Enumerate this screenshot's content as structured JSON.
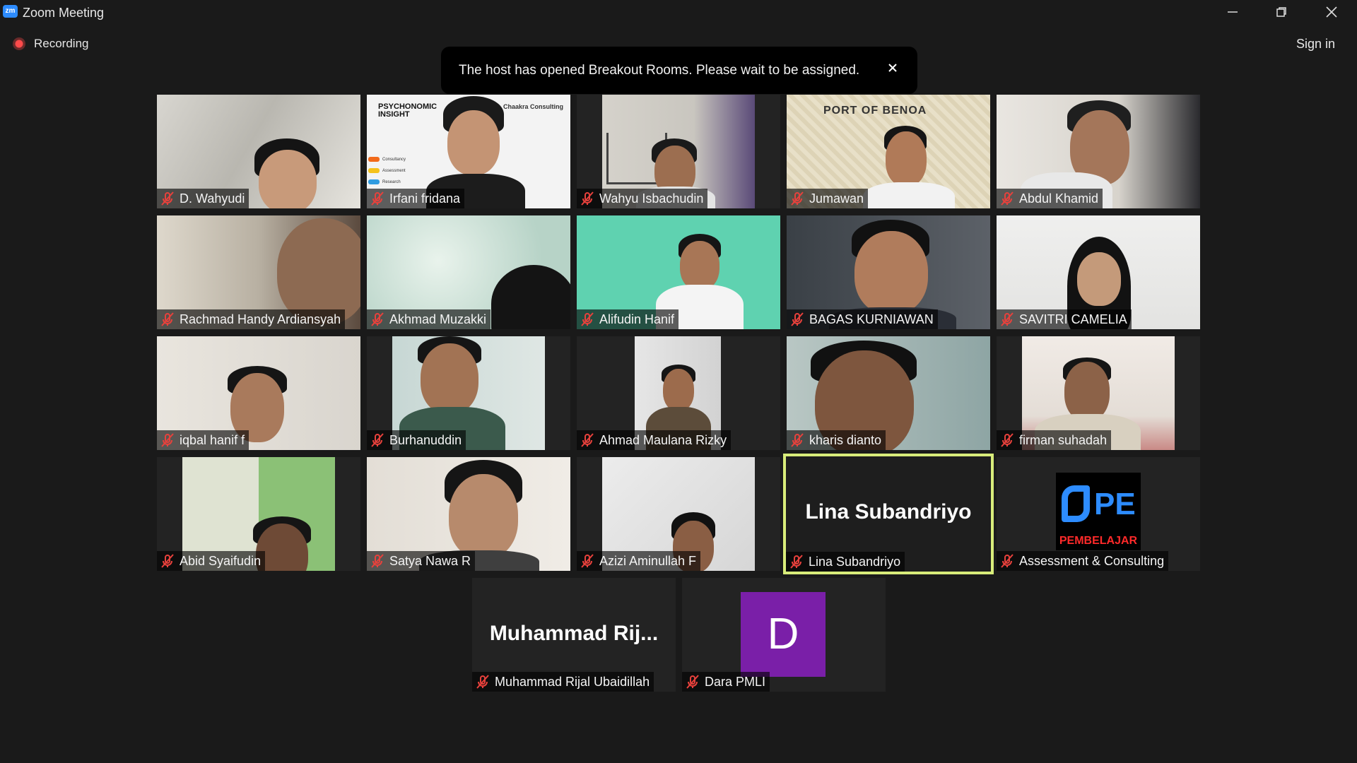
{
  "window": {
    "app_logo": "zm",
    "title": "Zoom Meeting"
  },
  "recording_label": "Recording",
  "sign_in_label": "Sign in",
  "toast": {
    "message": "The host has opened Breakout Rooms. Please wait to be assigned."
  },
  "participants": [
    {
      "name": "D. Wahyudi",
      "muted": true
    },
    {
      "name": "Irfani fridana",
      "muted": true,
      "poster": {
        "title": "PSYCHONOMIC INSIGHT",
        "brand": "Chaakra Consulting",
        "items": [
          "Consultancy",
          "Assessment",
          "Research"
        ]
      }
    },
    {
      "name": "Wahyu Isbachudin",
      "muted": true
    },
    {
      "name": "Jumawan",
      "muted": true,
      "sign": "PORT OF BENOA"
    },
    {
      "name": "Abdul Khamid",
      "muted": true
    },
    {
      "name": "Rachmad Handy Ardiansyah",
      "muted": true
    },
    {
      "name": "Akhmad Muzakki",
      "muted": true
    },
    {
      "name": "Alifudin Hanif",
      "muted": true
    },
    {
      "name": "BAGAS KURNIAWAN",
      "muted": true
    },
    {
      "name": "SAVITRI CAMELIA",
      "muted": true
    },
    {
      "name": "iqbal hanif f",
      "muted": true
    },
    {
      "name": "Burhanuddin",
      "muted": true
    },
    {
      "name": "Ahmad Maulana Rizky",
      "muted": true
    },
    {
      "name": "kharis dianto",
      "muted": true
    },
    {
      "name": "firman suhadah",
      "muted": true
    },
    {
      "name": "Abid Syaifudin",
      "muted": true
    },
    {
      "name": "Satya Nawa R",
      "muted": true
    },
    {
      "name": "Azizi Aminullah F",
      "muted": true
    },
    {
      "name": "Lina Subandriyo",
      "muted": true,
      "active_speaker": true,
      "display_name": "Lina Subandriyo"
    },
    {
      "name": "Assessment & Consulting",
      "muted": true,
      "logo": {
        "mark": "PE",
        "sub": "PEMBELAJAR"
      }
    },
    {
      "name": "Muhammad Rijal Ubaidillah",
      "muted": true,
      "display_name": "Muhammad  Rij..."
    },
    {
      "name": "Dara PMLI",
      "muted": true,
      "avatar_letter": "D",
      "avatar_color": "#7a1fa8"
    }
  ],
  "colors": {
    "background": "#1a1a1a",
    "active_speaker_border": "#d8ec7a",
    "muted_icon": "#e8413c",
    "recording": "#ff4b4b"
  }
}
